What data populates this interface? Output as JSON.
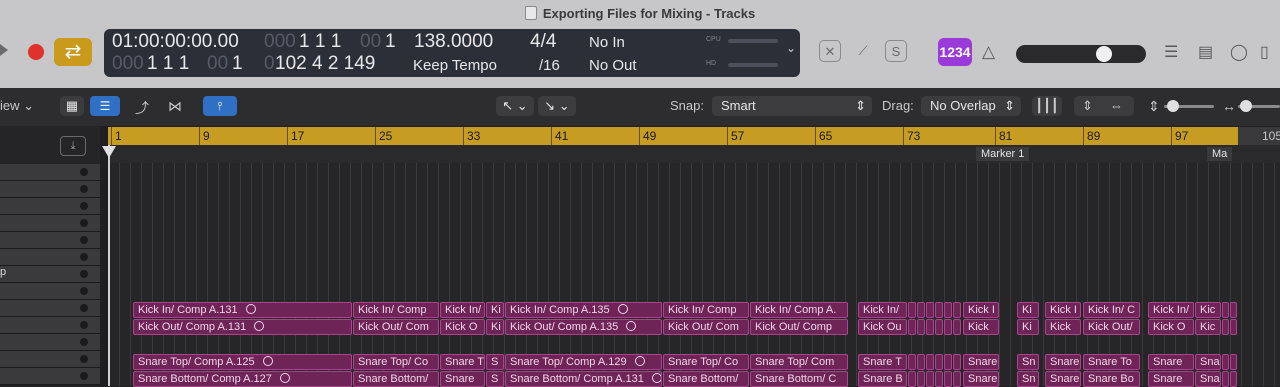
{
  "window": {
    "title": "Exporting Files for Mixing - Tracks"
  },
  "lcd": {
    "time": "01:00:00:00.00",
    "bars_dim": "000",
    "bars": "1 1 1",
    "bars_sub_dim": "00",
    "bars_sub": "1",
    "tempo": "138.0000",
    "signature": "4/4",
    "division": "/16",
    "in": "No In",
    "out": "No Out",
    "keep_tempo": "Keep Tempo",
    "row2_a_dim": "000",
    "row2_a": "1 1 1",
    "row2_a_sub_dim": "00",
    "row2_a_sub": "1",
    "row2_b_dim": "0",
    "row2_b": "102  4  2  149",
    "cpu": "CPU",
    "hd": "HD"
  },
  "transport": {
    "count_in": "1234"
  },
  "toolbar": {
    "view_label": "iew",
    "snap_label": "Snap:",
    "snap_value": "Smart",
    "drag_label": "Drag:",
    "drag_value": "No Overlap"
  },
  "ruler": {
    "bars": [
      "1",
      "9",
      "17",
      "25",
      "33",
      "41",
      "49",
      "57",
      "65",
      "73",
      "81",
      "89",
      "97",
      "105"
    ]
  },
  "markers": [
    {
      "label": "Marker 1"
    },
    {
      "label": "Ma"
    }
  ],
  "tracks": [
    {
      "label": ""
    },
    {
      "label": ""
    },
    {
      "label": ""
    },
    {
      "label": ""
    },
    {
      "label": ""
    },
    {
      "label": ""
    },
    {
      "label": "p"
    },
    {
      "label": ""
    },
    {
      "label": ""
    },
    {
      "label": ""
    },
    {
      "label": ""
    },
    {
      "label": ""
    },
    {
      "label": ""
    }
  ],
  "regions": {
    "kick_in": [
      "Kick In/ Comp A.131",
      "Kick In/ Comp",
      "Kick In/",
      "Ki",
      "Kick In/ Comp A.135",
      "Kick In/ Comp",
      "Kick In/ Comp A.",
      "Kick In/",
      "Kick I",
      "Ki",
      "Kick I",
      "Kick In/ C",
      "Kick In/",
      "Kic"
    ],
    "kick_out": [
      "Kick Out/ Comp A.131",
      "Kick Out/ Com",
      "Kick O",
      "Ki",
      "Kick Out/ Comp A.135",
      "Kick Out/ Com",
      "Kick Out/ Comp",
      "Kick Ou",
      "Kick",
      "Ki",
      "Kick",
      "Kick Out/",
      "Kick O",
      "Kic"
    ],
    "snare_top": [
      "Snare Top/ Comp A.125",
      "Snare Top/ Co",
      "Snare T",
      "S",
      "Snare Top/ Comp A.129",
      "Snare Top/ Co",
      "Snare Top/ Com",
      "Snare T",
      "Snare",
      "Sn",
      "Snare",
      "Snare To",
      "Snare",
      "Sna"
    ],
    "snare_bottom": [
      "Snare Bottom/ Comp A.127",
      "Snare Bottom/",
      "Snare",
      "S",
      "Snare Bottom/ Comp A.131",
      "Snare Bottom/",
      "Snare Bottom/ C",
      "Snare B",
      "Snare",
      "Sn",
      "Snare",
      "Snare Bo",
      "Snare",
      "Sna"
    ]
  },
  "colors": {
    "region": "#6e2457",
    "ruler": "#c79c22",
    "count_in": "#9a3ad8",
    "cycle": "#c99a1c",
    "record": "#e0312c"
  }
}
